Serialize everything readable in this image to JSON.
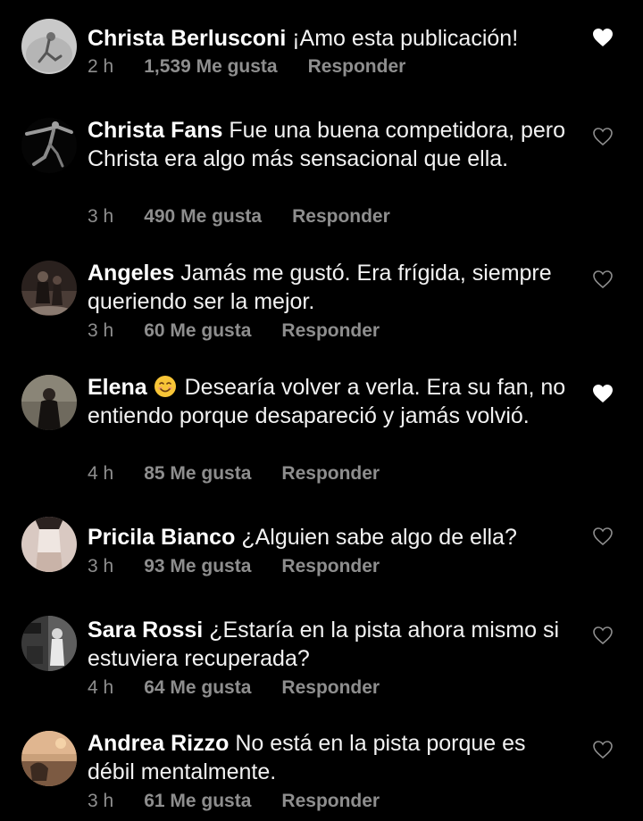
{
  "comments": [
    {
      "username": "Christa Berlusconi",
      "text": "¡Amo esta publicación!",
      "time": "2 h",
      "likes": "1,539 Me gusta",
      "reply": "Responder",
      "liked": true
    },
    {
      "username": "Christa Fans",
      "text": "Fue una buena competidora, pero Christa era algo más sensacional que ella.",
      "time": "3 h",
      "likes": "490 Me gusta",
      "reply": "Responder",
      "liked": false
    },
    {
      "username": "Angeles",
      "text": "Jamás me gustó. Era frígida, siempre queriendo ser la mejor.",
      "time": "3 h",
      "likes": "60 Me gusta",
      "reply": "Responder",
      "liked": false
    },
    {
      "username": "Elena",
      "emoji": "smiling-face-emoji",
      "text": "Desearía volver a verla. Era su fan, no entiendo porque desapareció y jamás volvió.",
      "time": "4 h",
      "likes": "85 Me gusta",
      "reply": "Responder",
      "liked": true
    },
    {
      "username": "Pricila Bianco",
      "text": "¿Alguien sabe algo de ella?",
      "time": "3 h",
      "likes": "93 Me gusta",
      "reply": "Responder",
      "liked": false
    },
    {
      "username": "Sara Rossi",
      "text": "¿Estaría en la pista ahora mismo si estuviera recuperada?",
      "time": "4 h",
      "likes": "64 Me gusta",
      "reply": "Responder",
      "liked": false
    },
    {
      "username": "Andrea Rizzo",
      "text": "No está en la pista porque es débil mentalmente.",
      "time": "3 h",
      "likes": "61 Me gusta",
      "reply": "Responder",
      "liked": false
    }
  ],
  "icons": {
    "heart_filled": "heart-filled-icon",
    "heart_outline": "heart-outline-icon"
  },
  "colors": {
    "background": "#000000",
    "text": "#f2f2f2",
    "meta": "#8e8e8e",
    "heart_outline": "#8e8e8e",
    "heart_filled": "#ffffff"
  }
}
